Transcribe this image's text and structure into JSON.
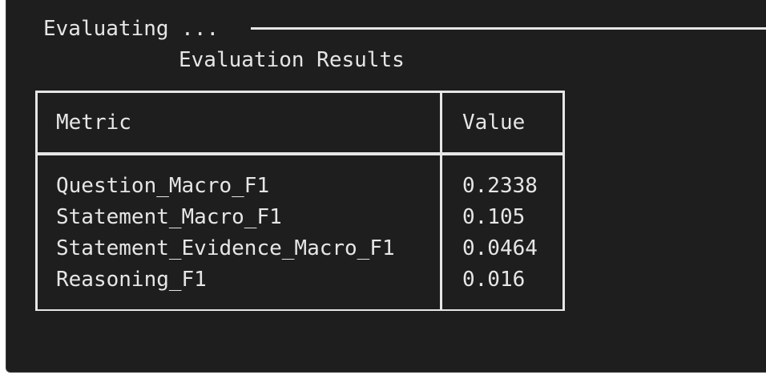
{
  "status": {
    "text": "Evaluating ..."
  },
  "table": {
    "title": "Evaluation Results",
    "headers": {
      "metric": "Metric",
      "value": "Value"
    },
    "rows": [
      {
        "metric": "Question_Macro_F1",
        "value": "0.2338"
      },
      {
        "metric": "Statement_Macro_F1",
        "value": "0.105"
      },
      {
        "metric": "Statement_Evidence_Macro_F1",
        "value": "0.0464"
      },
      {
        "metric": "Reasoning_F1",
        "value": "0.016"
      }
    ]
  },
  "colors": {
    "background": "#1e1e1e",
    "text": "#e6e6e6"
  }
}
